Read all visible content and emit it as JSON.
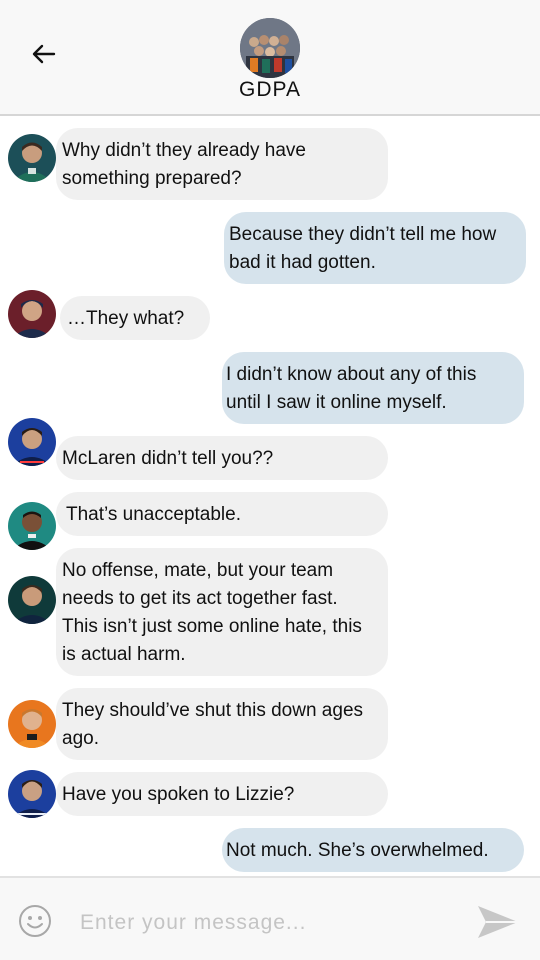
{
  "header": {
    "title": "GDPA"
  },
  "messages": [
    {
      "side": "left",
      "avatar": "teal",
      "text": "Why didn’t they already have something prepared?"
    },
    {
      "side": "right",
      "text": "Because they didn’t tell me how bad it had gotten."
    },
    {
      "side": "left",
      "avatar": "maroon",
      "text": "…They what?"
    },
    {
      "side": "right",
      "text": "I didn’t know about any of this until I saw it online myself."
    },
    {
      "side": "left",
      "avatar": "blue",
      "text": "McLaren didn’t tell you??"
    },
    {
      "side": "left",
      "avatar": "teal2",
      "text": " That’s unacceptable."
    },
    {
      "side": "left",
      "avatar": "green",
      "text": "No offense, mate, but your team needs to get its act together fast. This isn’t just some online hate, this is actual harm."
    },
    {
      "side": "left",
      "avatar": "orange",
      "text": "They should’ve shut this down ages ago."
    },
    {
      "side": "left",
      "avatar": "blue2",
      "text": "Have you spoken to Lizzie?"
    },
    {
      "side": "right",
      "text": "Not much. She’s overwhelmed."
    }
  ],
  "footer": {
    "placeholder": "Enter your message..."
  },
  "colors": {
    "incoming_bubble": "#f0f0f0",
    "outgoing_bubble": "#d6e3ec",
    "bar": "#f8f8f8"
  }
}
